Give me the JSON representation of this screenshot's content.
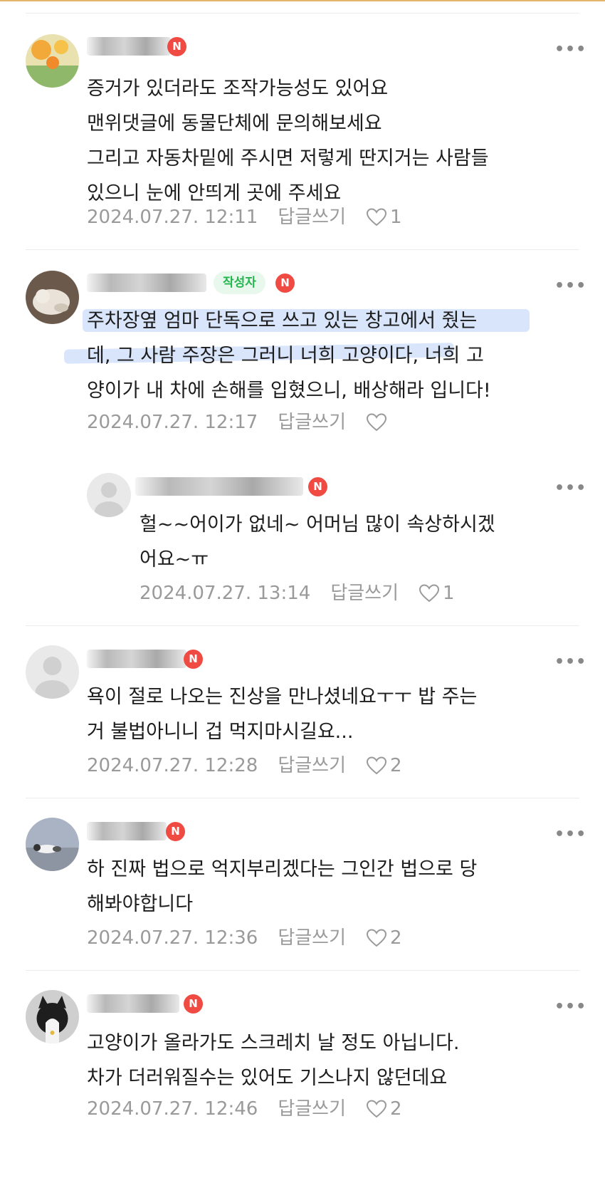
{
  "comments": [
    {
      "author_badge": "",
      "new_badge": "N",
      "lines": [
        "증거가 있더라도 조작가능성도 있어요",
        "맨위댓글에 동물단체에 문의해보세요",
        "그리고 자동차밑에 주시면 저렇게 딴지거는 사람들",
        "있으니 눈에 안띄게 곳에 주세요"
      ],
      "date": "2024.07.27. 12:11",
      "reply_label": "답글쓰기",
      "likes": "1",
      "avatar_icon": "flower-photo-avatar"
    },
    {
      "author_badge": "작성자",
      "new_badge": "N",
      "lines": [
        "주차장옆 엄마 단독으로 쓰고 있는 창고에서 줬는",
        "데, 그 사람 주장은 그러니 너희 고양이다, 너희 고",
        "양이가 내 차에 손해를 입혔으니, 배상해라 입니다!"
      ],
      "date": "2024.07.27. 12:17",
      "reply_label": "답글쓰기",
      "likes": "",
      "avatar_icon": "cat-photo-avatar"
    },
    {
      "author_badge": "",
      "new_badge": "N",
      "lines": [
        "헐~~어이가 없네~ 어머님 많이 속상하시겠",
        "어요~ㅠ"
      ],
      "date": "2024.07.27. 13:14",
      "reply_label": "답글쓰기",
      "likes": "1",
      "avatar_icon": "default-person-avatar"
    },
    {
      "author_badge": "",
      "new_badge": "N",
      "lines": [
        "욕이 절로 나오는 진상을 만나셨네요ㅜㅜ 밥 주는",
        "거 불법아니니 겁 먹지마시길요..."
      ],
      "date": "2024.07.27. 12:28",
      "reply_label": "답글쓰기",
      "likes": "2",
      "avatar_icon": "default-person-avatar"
    },
    {
      "author_badge": "",
      "new_badge": "N",
      "lines": [
        "하 진짜 법으로 억지부리겠다는 그인간 법으로 당",
        "해봐야합니다"
      ],
      "date": "2024.07.27. 12:36",
      "reply_label": "답글쓰기",
      "likes": "2",
      "avatar_icon": "cat-on-road-avatar"
    },
    {
      "author_badge": "",
      "new_badge": "N",
      "lines": [
        "고양이가 올라가도 스크레치 날 정도 아닙니다.",
        "차가 더러워질수는 있어도 기스나지 않던데요"
      ],
      "date": "2024.07.27. 12:46",
      "reply_label": "답글쓰기",
      "likes": "2",
      "avatar_icon": "tuxedo-cat-avatar"
    }
  ],
  "more_label": "•••",
  "colors": {
    "accent_new": "#f04b43",
    "author_badge_text": "#23b64d",
    "meta": "#9a9a9a"
  }
}
